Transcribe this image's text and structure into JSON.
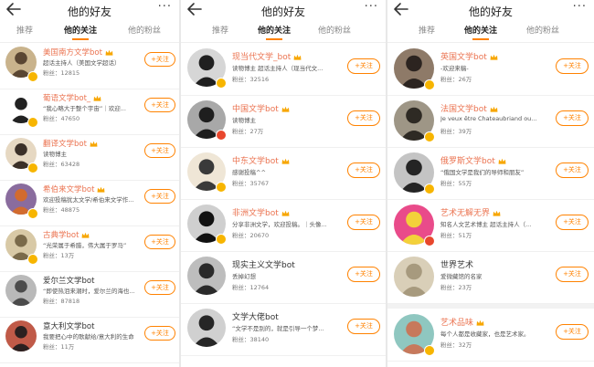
{
  "panels": [
    {
      "title": "他的好友",
      "tabs": [
        "推荐",
        "他的关注",
        "他的粉丝"
      ],
      "active_tab": 1,
      "users": [
        {
          "name": "美国南方文学bot",
          "verified": true,
          "desc": "超话主持人（美国文学超话）",
          "fans": "粉丝：12815",
          "follow": "+关注",
          "colors": [
            "#c9b38c",
            "#5a4632"
          ]
        },
        {
          "name": "葡语文学bot_",
          "verified": true,
          "desc": "“我心略大于整个宇宙”｜欢迎...",
          "fans": "粉丝：47650",
          "follow": "+关注",
          "colors": [
            "#ffffff",
            "#222222"
          ]
        },
        {
          "name": "翻译文学bot",
          "verified": true,
          "desc": "读物博主",
          "fans": "粉丝：63428",
          "follow": "+关注",
          "colors": [
            "#e6d8c2",
            "#3b3028"
          ]
        },
        {
          "name": "希伯来文学bot",
          "verified": true,
          "desc": "欢迎投稿犹太文学/希伯来文学作...",
          "fans": "粉丝：48875",
          "follow": "+关注",
          "colors": [
            "#8a6c9e",
            "#d26b2e"
          ]
        },
        {
          "name": "古典学bot",
          "verified": true,
          "desc": "“光荣属于希腊，伟大属于罗马”",
          "fans": "粉丝：13万",
          "follow": "+关注",
          "colors": [
            "#d8c9a6",
            "#7a6a4a"
          ]
        },
        {
          "name": "爱尔兰文学bot",
          "verified": false,
          "desc": "“即使热泪来潮时，爱尔兰的海也...",
          "fans": "粉丝：87818",
          "follow": "+关注",
          "colors": [
            "#b9b9b9",
            "#4b4b4b"
          ]
        },
        {
          "name": "意大利文学bot",
          "verified": false,
          "desc": "我要把心中的歌献给/意大利的生命",
          "fans": "粉丝：11万",
          "follow": "+关注",
          "colors": [
            "#c05a48",
            "#2b2020"
          ]
        }
      ]
    },
    {
      "title": "他的好友",
      "tabs": [
        "推荐",
        "他的关注",
        "他的粉丝"
      ],
      "active_tab": 1,
      "users": [
        {
          "name": "现当代文学_bot",
          "verified": true,
          "desc": "读物博主 超话主持人（现当代文...",
          "fans": "粉丝：32516",
          "follow": "+关注",
          "colors": [
            "#d6d6d6",
            "#202020"
          ]
        },
        {
          "name": "中国文学bot",
          "verified": true,
          "desc": "读物博主",
          "fans": "粉丝：27万",
          "follow": "+关注",
          "colors": [
            "#a8a8a8",
            "#1e1e1e"
          ]
        },
        {
          "name": "中东文学bot",
          "verified": true,
          "desc": "感谢投稿^^",
          "fans": "粉丝：35767",
          "follow": "+关注",
          "colors": [
            "#efe6d6",
            "#3a3a3a"
          ]
        },
        {
          "name": "非洲文学bot",
          "verified": true,
          "desc": "分享非洲文学，欢迎投稿。｜头像...",
          "fans": "粉丝：20670",
          "follow": "+关注",
          "colors": [
            "#cfcfcf",
            "#111111"
          ]
        },
        {
          "name": "现实主义文学bot",
          "verified": false,
          "desc": "丢掉幻想",
          "fans": "粉丝：12764",
          "follow": "+关注",
          "colors": [
            "#bdbdbd",
            "#2a2a2a"
          ]
        },
        {
          "name": "文学大佬bot",
          "verified": false,
          "desc": "“文学不是别的，就是引导一个梦...",
          "fans": "粉丝：38140",
          "follow": "+关注",
          "colors": [
            "#d0d0d0",
            "#262626"
          ]
        }
      ]
    },
    {
      "title": "他的好友",
      "tabs": [
        "推荐",
        "他的关注",
        "他的粉丝"
      ],
      "active_tab": 1,
      "users": [
        {
          "name": "英国文学bot",
          "verified": true,
          "desc": "-欢迎来稿-",
          "fans": "粉丝：26万",
          "follow": "+关注",
          "colors": [
            "#8e7a68",
            "#2c2420"
          ]
        },
        {
          "name": "法国文学bot",
          "verified": true,
          "desc": "Je veux être Chateaubriand ou...",
          "fans": "粉丝：39万",
          "follow": "+关注",
          "colors": [
            "#9e9686",
            "#2e2a24"
          ]
        },
        {
          "name": "俄罗斯文学bot",
          "verified": true,
          "desc": "“俄国文学是我们的导师和朋友”",
          "fans": "粉丝：55万",
          "follow": "+关注",
          "colors": [
            "#c4c4c4",
            "#242424"
          ]
        },
        {
          "name": "艺术无解无界",
          "verified": true,
          "desc": "知名人文艺术博主 超话主持人（...",
          "fans": "粉丝：51万",
          "follow": "+关注",
          "colors": [
            "#e94b8a",
            "#f3d13a"
          ]
        },
        {
          "name": "世界艺术",
          "verified": false,
          "desc": "爱微藏馆的名家",
          "fans": "粉丝：23万",
          "follow": "+关注",
          "colors": [
            "#d9cfb8",
            "#a79a7e"
          ]
        },
        {
          "name": "艺术品味",
          "verified": true,
          "desc": "每个人都是收藏家，也是艺术家。",
          "fans": "粉丝：32万",
          "follow": "+关注",
          "colors": [
            "#8fc7c0",
            "#c7795c"
          ]
        }
      ]
    }
  ]
}
